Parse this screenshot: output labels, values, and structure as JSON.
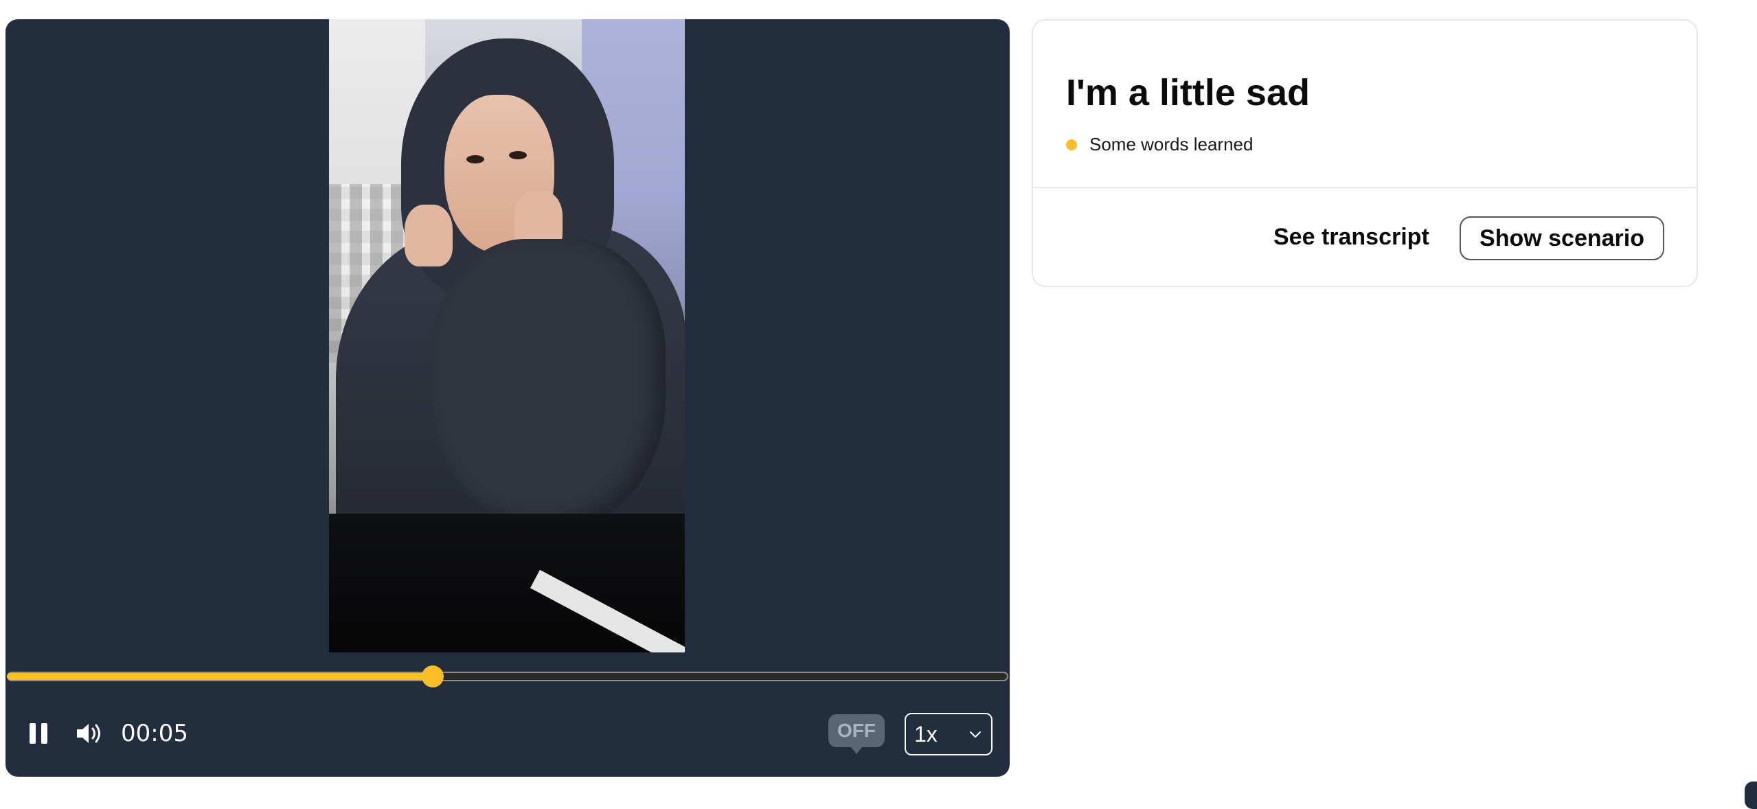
{
  "player": {
    "elapsed_time": "00:05",
    "progress_fraction": 0.425,
    "captions_toggle_label": "OFF",
    "playback_speed": "1x",
    "playing": true,
    "accent_color": "#fbbe24"
  },
  "lesson": {
    "title": "I'm a little sad",
    "status_text": "Some words learned",
    "status_color": "#fbbe24"
  },
  "actions": {
    "see_transcript_label": "See transcript",
    "show_scenario_label": "Show scenario"
  },
  "icons": {
    "pause": "pause-icon",
    "volume": "volume-icon",
    "chevron": "chevron-down-icon"
  }
}
